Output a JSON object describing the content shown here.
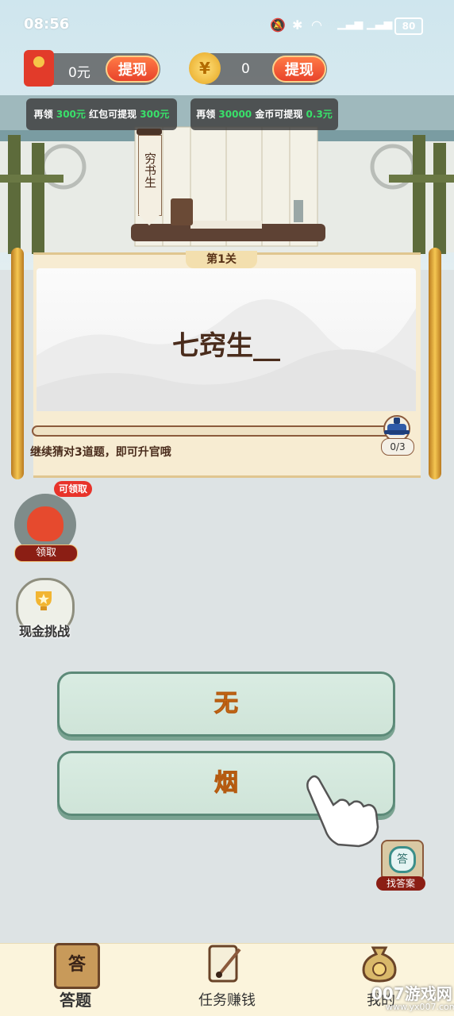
{
  "status_bar": {
    "time": "08:56",
    "battery": "80"
  },
  "top": {
    "redpacket_balance": "0元",
    "redpacket_withdraw": "提现",
    "coin_balance": "0",
    "coin_withdraw": "提现",
    "tip_left": {
      "pre": "再领",
      "amount": "300元",
      "mid": "红包可提现",
      "target": "300元"
    },
    "tip_right": {
      "pre": "再领",
      "amount": "30000",
      "mid": "金币可提现",
      "target": "0.3元"
    }
  },
  "banner_text": "穷书生",
  "card": {
    "level": "第1关",
    "question": "七窍生__",
    "progress_count": "0/3",
    "progress_fraction": 0,
    "hint": "继续猜对3道题，即可升官哦"
  },
  "side": {
    "claim_badge": "可领取",
    "claim_label": "领取",
    "cash_label": "现金挑战"
  },
  "answers": [
    "无",
    "烟"
  ],
  "find_answer": {
    "icon_text": "答",
    "label": "找答案"
  },
  "nav": {
    "items": [
      {
        "label": "答题",
        "icon": "答"
      },
      {
        "label": "任务赚钱"
      },
      {
        "label": "我的"
      }
    ]
  },
  "watermark": {
    "main": "007游戏网",
    "sub": "www.yx007.com"
  }
}
